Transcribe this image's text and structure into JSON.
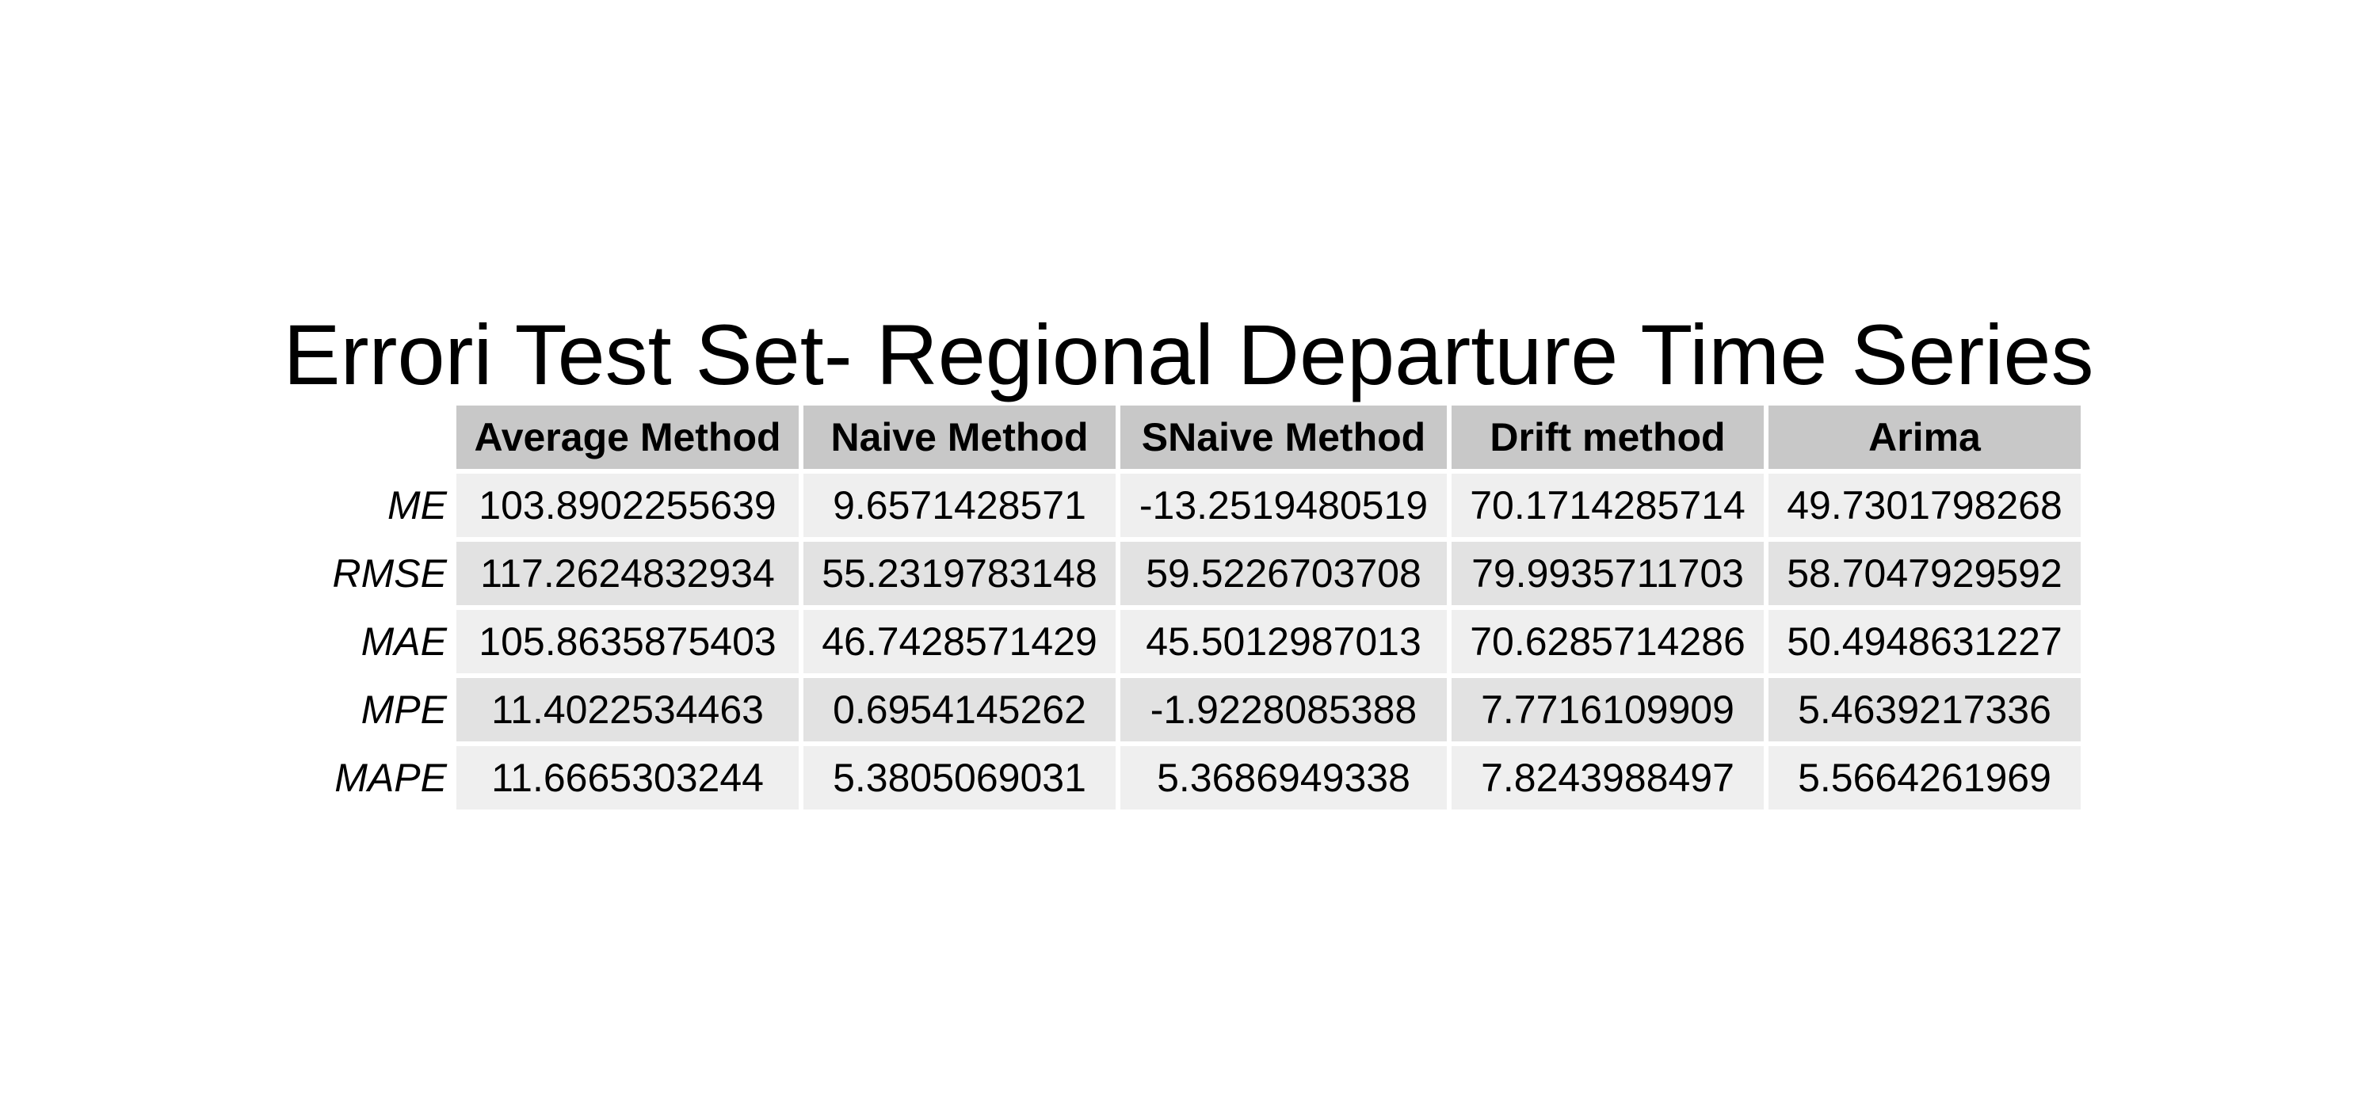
{
  "chart_data": {
    "type": "table",
    "title": "Errori Test Set- Regional Departure Time Series",
    "columns": [
      "Average Method",
      "Naive Method",
      "SNaive Method",
      "Drift method",
      "Arima"
    ],
    "rows": [
      {
        "label": "ME",
        "values": [
          "103.8902255639",
          "9.6571428571",
          "-13.2519480519",
          "70.1714285714",
          "49.7301798268"
        ]
      },
      {
        "label": "RMSE",
        "values": [
          "117.2624832934",
          "55.2319783148",
          "59.5226703708",
          "79.9935711703",
          "58.7047929592"
        ]
      },
      {
        "label": "MAE",
        "values": [
          "105.8635875403",
          "46.7428571429",
          "45.5012987013",
          "70.6285714286",
          "50.4948631227"
        ]
      },
      {
        "label": "MPE",
        "values": [
          "11.4022534463",
          "0.6954145262",
          "-1.9228085388",
          "7.7716109909",
          "5.4639217336"
        ]
      },
      {
        "label": "MAPE",
        "values": [
          "11.6665303244",
          "5.3805069031",
          "5.3686949338",
          "7.8243988497",
          "5.5664261969"
        ]
      }
    ]
  },
  "colors": {
    "header_fill": "#c8c8c8",
    "row_fill_light": "#efefef",
    "row_fill_dark": "#e2e2e2",
    "text": "#000000"
  }
}
